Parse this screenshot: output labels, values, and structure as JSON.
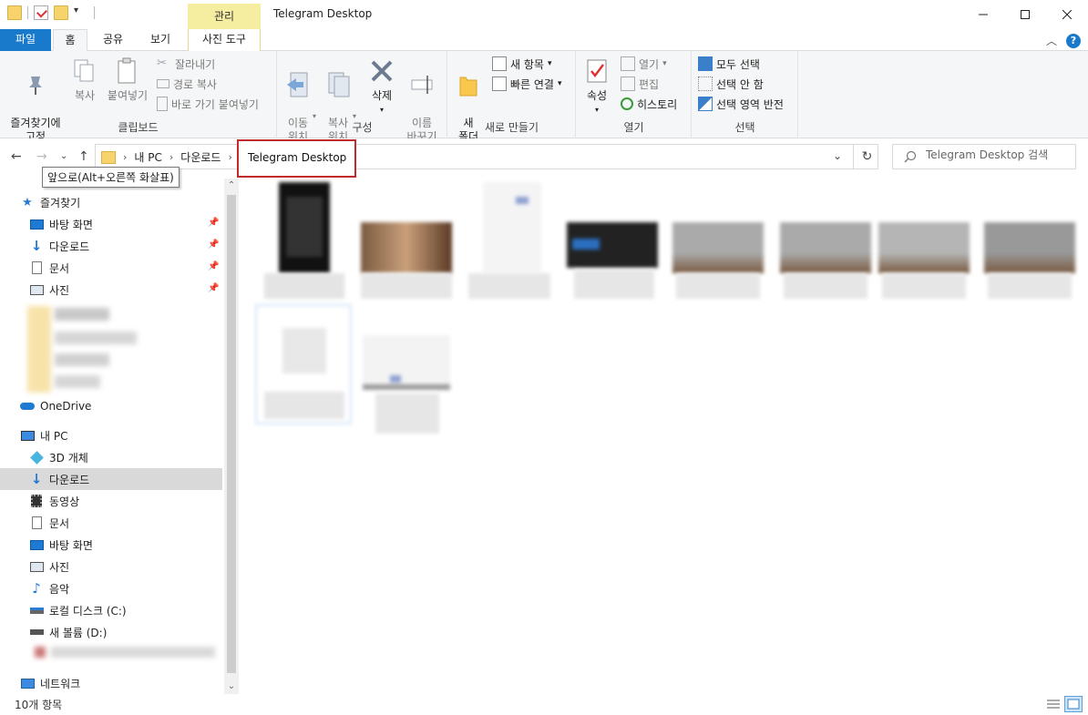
{
  "window": {
    "title": "Telegram Desktop",
    "context_tab": "관리"
  },
  "ribbon_tabs": [
    "파일",
    "홈",
    "공유",
    "보기",
    "사진 도구"
  ],
  "ribbon": {
    "clipboard": {
      "pin_quick": "즐겨찾기에\n고정",
      "copy": "복사",
      "paste": "붙여넣기",
      "cut": "잘라내기",
      "copy_path": "경로 복사",
      "paste_shortcut": "바로 가기 붙여넣기",
      "label": "클립보드"
    },
    "organize": {
      "move_to": "이동\n위치",
      "copy_to": "복사\n위치",
      "delete": "삭제",
      "rename": "이름\n바꾸기",
      "label": "구성"
    },
    "new": {
      "new_folder": "새\n폴더",
      "new_item": "새 항목",
      "easy_access": "빠른 연결",
      "label": "새로 만들기"
    },
    "open": {
      "properties": "속성",
      "open": "열기",
      "edit": "편집",
      "history": "히스토리",
      "label": "열기"
    },
    "select": {
      "select_all": "모두 선택",
      "select_none": "선택 안 함",
      "invert": "선택 영역 반전",
      "label": "선택"
    }
  },
  "address": {
    "crumbs": [
      "내 PC",
      "다운로드"
    ],
    "current": "Telegram Desktop",
    "search_placeholder": "Telegram Desktop 검색",
    "tooltip": "앞으로(Alt+오른쪽 화살표)"
  },
  "nav": {
    "quick_access": "즐겨찾기",
    "quick_items": [
      "바탕 화면",
      "다운로드",
      "문서",
      "사진"
    ],
    "onedrive": "OneDrive",
    "this_pc": "내 PC",
    "pc_items": [
      "3D 개체",
      "다운로드",
      "동영상",
      "문서",
      "바탕 화면",
      "사진",
      "음악",
      "로컬 디스크 (C:)",
      "새 볼륨 (D:)"
    ],
    "network": "네트워크"
  },
  "status": {
    "item_count": "10개 항목"
  },
  "colors": {
    "accent": "#1979ca",
    "context_tab": "#f5eea0",
    "highlight_box": "#c22b2b",
    "selected_nav": "#d9d9d9"
  }
}
